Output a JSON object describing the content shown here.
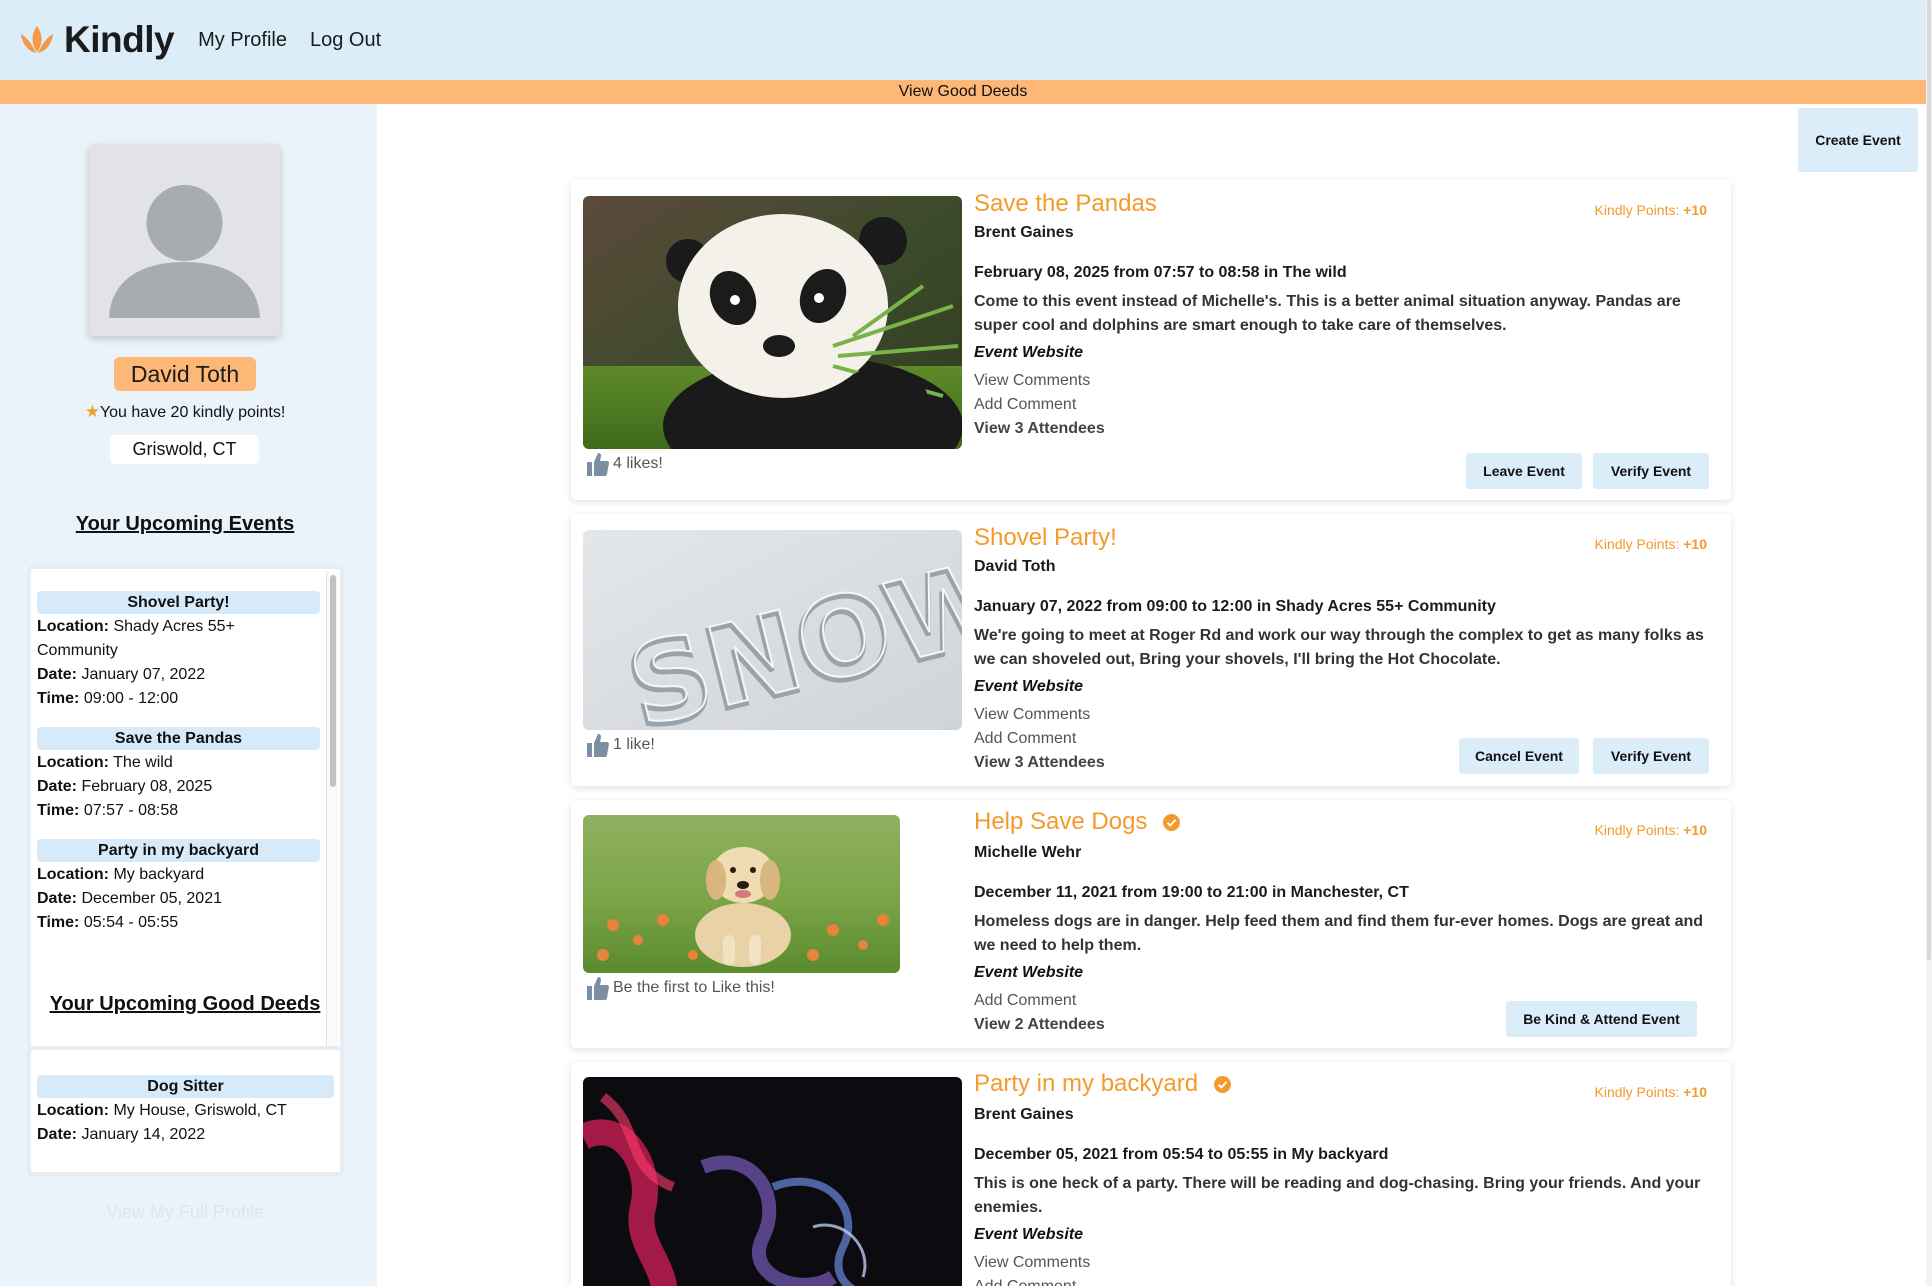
{
  "header": {
    "brand": "Kindly",
    "nav": [
      "My Profile",
      "Log Out"
    ],
    "subbar_link": "View Good Deeds"
  },
  "profile": {
    "name": "David Toth",
    "points_text": "You have 20 kindly points!",
    "location": "Griswold, CT",
    "upcoming_events_title": "Your Upcoming Events",
    "upcoming_deeds_title": "Your Upcoming Good Deeds",
    "full_profile_link": "View My Full Profile",
    "labels": {
      "location": "Location:",
      "date": "Date:",
      "time": "Time:"
    },
    "upcoming_events": [
      {
        "title": "Shovel Party!",
        "location": "Shady Acres 55+ Community",
        "date": "January 07, 2022",
        "time": "09:00 - 12:00"
      },
      {
        "title": "Save the Pandas",
        "location": "The wild",
        "date": "February 08, 2025",
        "time": "07:57 - 08:58"
      },
      {
        "title": "Party in my backyard",
        "location": "My backyard",
        "date": "December 05, 2021",
        "time": "05:54 - 05:55"
      }
    ],
    "upcoming_deeds": [
      {
        "title": "Dog Sitter",
        "location": "My House, Griswold, CT",
        "date": "January 14, 2022"
      }
    ]
  },
  "main": {
    "create_event": "Create Event",
    "kindly_points_label": "Kindly Points:",
    "event_website_label": "Event Website",
    "events": [
      {
        "title": "Save the Pandas",
        "host": "Brent Gaines",
        "when": "February 08, 2025 from 07:57 to 08:58 in The wild",
        "description": "Come to this event instead of Michelle's. This is a better animal situation anyway. Pandas are super cool and dolphins are smart enough to take care of themselves.",
        "points": "+10",
        "likes": "4 likes!",
        "view_comments": "View Comments",
        "add_comment": "Add Comment",
        "attendees": "View 3 Attendees",
        "buttons": [
          "Leave Event",
          "Verify Event"
        ]
      },
      {
        "title": "Shovel Party!",
        "host": "David Toth",
        "when": "January 07, 2022 from 09:00 to 12:00 in Shady Acres 55+ Community",
        "description": "We're going to meet at Roger Rd and work our way through the complex to get as many folks as we can shoveled out, Bring your shovels, I'll bring the Hot Chocolate.",
        "points": "+10",
        "likes": "1 like!",
        "view_comments": "View Comments",
        "add_comment": "Add Comment",
        "attendees": "View 3 Attendees",
        "buttons": [
          "Cancel Event",
          "Verify Event"
        ]
      },
      {
        "title": "Help Save Dogs",
        "host": "Michelle Wehr",
        "when": "December 11, 2021 from 19:00 to 21:00 in Manchester, CT",
        "description": "Homeless dogs are in danger. Help feed them and find them fur-ever homes. Dogs are great and we need to help them.",
        "points": "+10",
        "likes": "Be the first to Like this!",
        "add_comment": "Add Comment",
        "attendees": "View 2 Attendees",
        "buttons": [
          "Be Kind & Attend Event"
        ]
      },
      {
        "title": "Party in my backyard",
        "host": "Brent Gaines",
        "when": "December 05, 2021 from 05:54 to 05:55 in My backyard",
        "description": "This is one heck of a party. There will be reading and dog-chasing. Bring your friends. And your enemies.",
        "points": "+10",
        "view_comments": "View Comments",
        "add_comment": "Add Comment"
      }
    ]
  },
  "colors": {
    "accent": "#f39a2b",
    "header_bg": "#dcedfa",
    "subbar_bg": "#fdb776",
    "sidebar_bg": "#eaf2fa"
  },
  "icons": [
    "lotus-logo-icon",
    "star-icon",
    "thumbs-up-icon",
    "verified-badge-icon",
    "user-silhouette-icon"
  ]
}
